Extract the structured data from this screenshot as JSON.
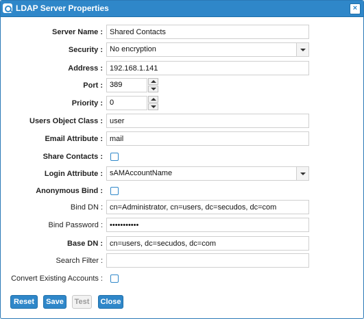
{
  "window": {
    "title": "LDAP Server Properties",
    "close_glyph": "×"
  },
  "form": {
    "server_name": {
      "label": "Server Name :",
      "value": "Shared Contacts"
    },
    "security": {
      "label": "Security :",
      "value": "No encryption"
    },
    "address": {
      "label": "Address :",
      "value": "192.168.1.141"
    },
    "port": {
      "label": "Port :",
      "value": "389"
    },
    "priority": {
      "label": "Priority :",
      "value": "0"
    },
    "users_object_class": {
      "label": "Users Object Class :",
      "value": "user"
    },
    "email_attribute": {
      "label": "Email Attribute :",
      "value": "mail"
    },
    "share_contacts": {
      "label": "Share Contacts :",
      "checked": false
    },
    "login_attribute": {
      "label": "Login Attribute :",
      "value": "sAMAccountName"
    },
    "anonymous_bind": {
      "label": "Anonymous Bind :",
      "checked": false
    },
    "bind_dn": {
      "label": "Bind DN :",
      "value": "cn=Administrator, cn=users, dc=secudos, dc=com"
    },
    "bind_password": {
      "label": "Bind Password :",
      "value": "•••••••••••"
    },
    "base_dn": {
      "label": "Base DN :",
      "value": "cn=users, dc=secudos, dc=com"
    },
    "search_filter": {
      "label": "Search Filter :",
      "value": ""
    },
    "convert_existing": {
      "label": "Convert Existing Accounts :",
      "checked": false
    }
  },
  "buttons": {
    "reset": "Reset",
    "save": "Save",
    "test": "Test",
    "close": "Close"
  },
  "colors": {
    "accent": "#2f87c9",
    "disabled": "#f2f2f2"
  }
}
